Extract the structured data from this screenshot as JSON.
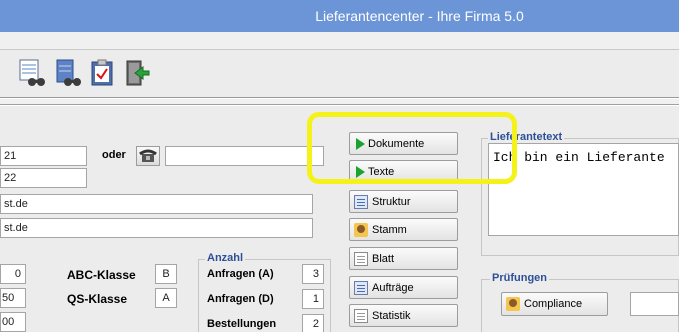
{
  "window": {
    "title": "Lieferantencenter - Ihre Firma 5.0"
  },
  "toolbar": {
    "icons": [
      "table-search-icon",
      "server-search-icon",
      "clipboard-check-icon",
      "exit-door-icon"
    ]
  },
  "contact": {
    "phone1": "21",
    "oder_label": "oder",
    "phone2": "22",
    "email1": "st.de",
    "email2": "st.de",
    "oder_value": ""
  },
  "stats": {
    "left_values": [
      "0",
      "50",
      "00"
    ],
    "abc_label": "ABC-Klasse",
    "abc_value": "B",
    "qs_label": "QS-Klasse",
    "qs_value": "A"
  },
  "anzahl": {
    "title": "Anzahl",
    "rows": [
      {
        "label": "Anfragen (A)",
        "value": "3"
      },
      {
        "label": "Anfragen (D)",
        "value": "1"
      },
      {
        "label": "Bestellungen",
        "value": "2"
      }
    ]
  },
  "buttons": {
    "dokumente": "Dokumente",
    "texte": "Texte",
    "struktur": "Struktur",
    "stamm": "Stamm",
    "blatt": "Blatt",
    "auftraege": "Aufträge",
    "statistik": "Statistik"
  },
  "lieferantetext": {
    "title": "Lieferantetext",
    "content": "Ich bin ein Lieferante"
  },
  "pruefungen": {
    "title": "Prüfungen",
    "compliance": "Compliance",
    "field_value": ""
  },
  "colors": {
    "titlebar": "#6b95d6",
    "highlight": "#f4f218",
    "group_title": "#2d4f97"
  }
}
